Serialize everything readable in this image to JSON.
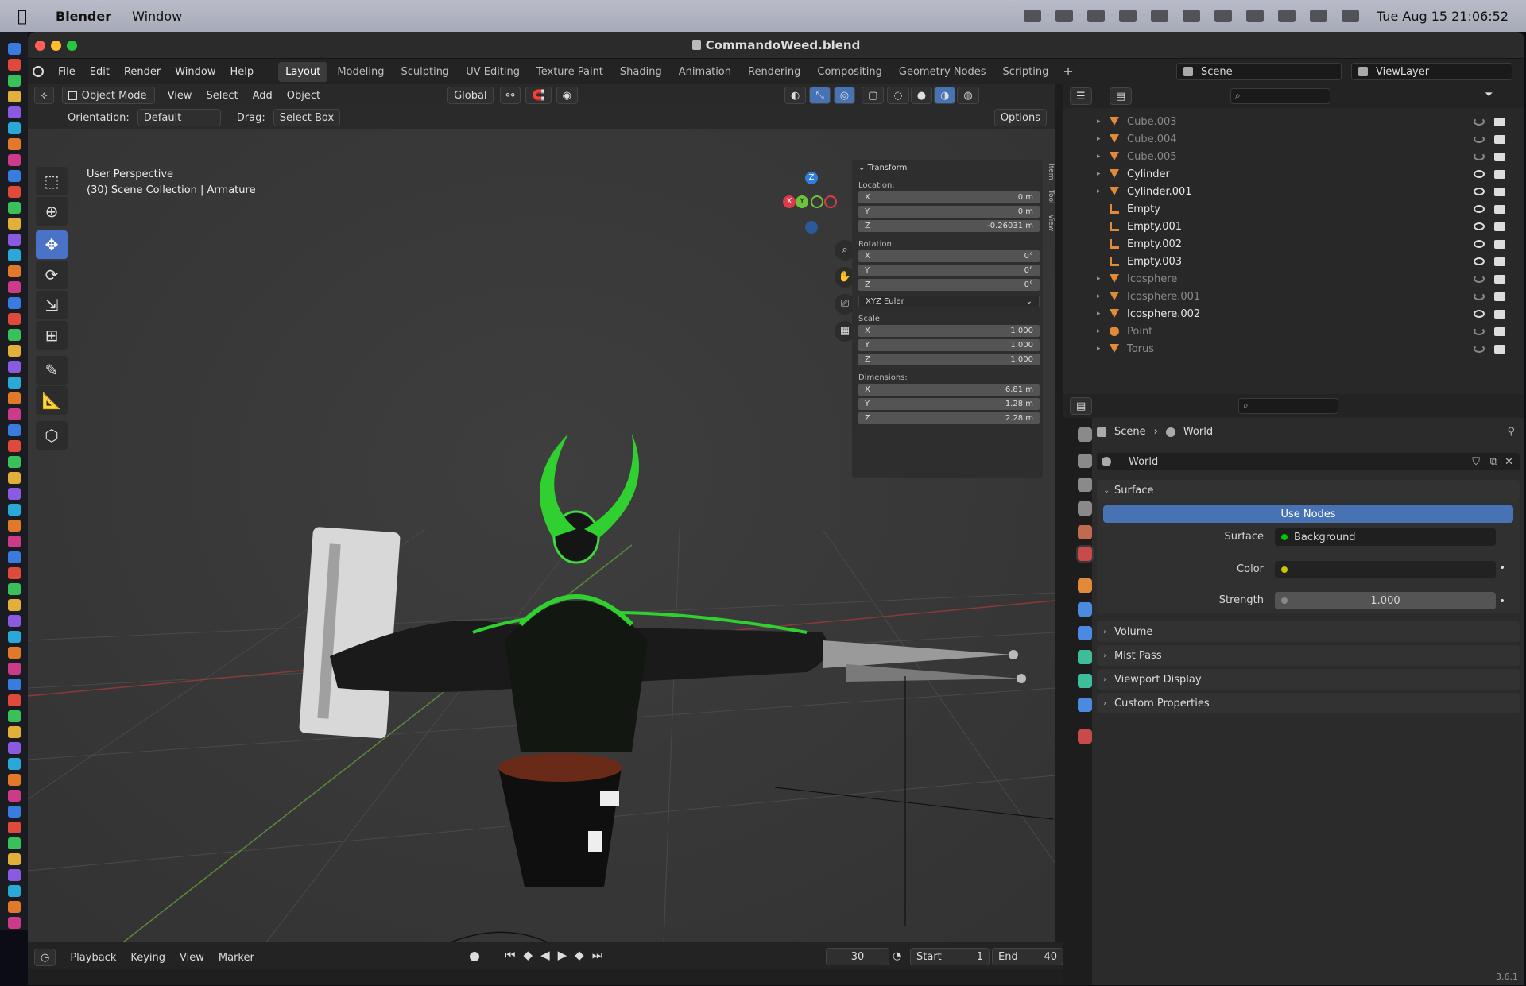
{
  "os": {
    "app_name": "Blender",
    "menu": [
      "Window"
    ],
    "clock": "Tue Aug 15  21:06:52"
  },
  "window": {
    "title": "CommandoWeed.blend",
    "version": "3.6.1"
  },
  "topbar": {
    "menus": [
      "File",
      "Edit",
      "Render",
      "Window",
      "Help"
    ],
    "workspaces": [
      "Layout",
      "Modeling",
      "Sculpting",
      "UV Editing",
      "Texture Paint",
      "Shading",
      "Animation",
      "Rendering",
      "Compositing",
      "Geometry Nodes",
      "Scripting"
    ],
    "active_workspace": "Layout",
    "plus": "+",
    "scene": "Scene",
    "viewlayer": "ViewLayer"
  },
  "viewport": {
    "mode": "Object Mode",
    "menus": [
      "View",
      "Select",
      "Add",
      "Object"
    ],
    "transform_space": "Global",
    "orientation_label": "Orientation:",
    "orientation": "Default",
    "drag_label": "Drag:",
    "drag": "Select Box",
    "options": "Options",
    "info_line1": "User Perspective",
    "info_line2": "(30) Scene Collection | Armature",
    "gizmo": {
      "z": "Z",
      "y": "Y",
      "x": "X"
    },
    "side_tabs": [
      "Item",
      "Tool",
      "View"
    ]
  },
  "transform": {
    "title": "Transform",
    "location_label": "Location:",
    "rotation_label": "Rotation:",
    "scale_label": "Scale:",
    "dimensions_label": "Dimensions:",
    "axes": [
      "X",
      "Y",
      "Z"
    ],
    "location": [
      "0 m",
      "0 m",
      "-0.26031 m"
    ],
    "rotation": [
      "0°",
      "0°",
      "0°"
    ],
    "rotation_mode": "XYZ Euler",
    "scale": [
      "1.000",
      "1.000",
      "1.000"
    ],
    "dimensions": [
      "6.81 m",
      "1.28 m",
      "2.28 m"
    ]
  },
  "timeline": {
    "menus": [
      "Playback",
      "Keying",
      "View",
      "Marker"
    ],
    "current_frame": "30",
    "start_label": "Start",
    "start": "1",
    "end_label": "End",
    "end": "40"
  },
  "outliner": {
    "items": [
      {
        "name": "Cube.003",
        "type": "mesh",
        "visible": false
      },
      {
        "name": "Cube.004",
        "type": "mesh",
        "visible": false
      },
      {
        "name": "Cube.005",
        "type": "mesh",
        "visible": false
      },
      {
        "name": "Cylinder",
        "type": "mesh",
        "visible": true
      },
      {
        "name": "Cylinder.001",
        "type": "mesh",
        "visible": true
      },
      {
        "name": "Empty",
        "type": "empty",
        "visible": true
      },
      {
        "name": "Empty.001",
        "type": "empty",
        "visible": true
      },
      {
        "name": "Empty.002",
        "type": "empty",
        "visible": true
      },
      {
        "name": "Empty.003",
        "type": "empty",
        "visible": true
      },
      {
        "name": "Icosphere",
        "type": "mesh",
        "visible": false
      },
      {
        "name": "Icosphere.001",
        "type": "mesh",
        "visible": false
      },
      {
        "name": "Icosphere.002",
        "type": "mesh",
        "visible": true
      },
      {
        "name": "Point",
        "type": "light",
        "visible": false
      },
      {
        "name": "Torus",
        "type": "mesh",
        "visible": false
      }
    ]
  },
  "properties": {
    "breadcrumb_scene": "Scene",
    "breadcrumb_world": "World",
    "world_name": "World",
    "surface_section": "Surface",
    "use_nodes": "Use Nodes",
    "surface_label": "Surface",
    "surface_value": "Background",
    "color_label": "Color",
    "strength_label": "Strength",
    "strength_value": "1.000",
    "collapsed_sections": [
      "Volume",
      "Mist Pass",
      "Viewport Display",
      "Custom Properties"
    ]
  },
  "colors": {
    "accent": "#4772b3",
    "green": "#00c600",
    "mesh_icon": "#e08a3a",
    "vertex_icon": "#3dbd9a"
  }
}
